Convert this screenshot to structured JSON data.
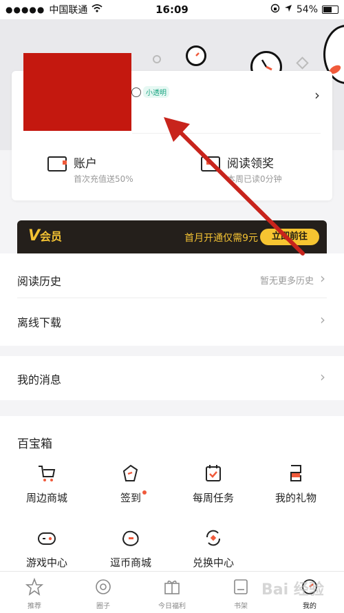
{
  "status_bar": {
    "carrier": "中国联通",
    "time": "16:09",
    "battery": "54%"
  },
  "profile": {
    "badge": "小透明"
  },
  "stats": [
    {
      "title": "账户",
      "sub": "首次充值送50%"
    },
    {
      "title": "阅读领奖",
      "sub": "本周已读0分钟"
    }
  ],
  "vip": {
    "logo_v": "V",
    "logo_text": "会员",
    "promo": "首月开通仅需9元",
    "button": "立即前往"
  },
  "rows": {
    "history": {
      "label": "阅读历史",
      "hint": "暂无更多历史"
    },
    "offline": {
      "label": "离线下载"
    },
    "messages": {
      "label": "我的消息"
    }
  },
  "toolbox": {
    "title": "百宝箱",
    "items": [
      {
        "label": "周边商城",
        "icon": "cart-icon"
      },
      {
        "label": "签到",
        "icon": "checkin-icon"
      },
      {
        "label": "每周任务",
        "icon": "task-icon"
      },
      {
        "label": "我的礼物",
        "icon": "gift-icon"
      },
      {
        "label": "游戏中心",
        "icon": "gamepad-icon"
      },
      {
        "label": "逗币商城",
        "icon": "coin-shop-icon"
      },
      {
        "label": "兑换中心",
        "icon": "exchange-icon"
      }
    ]
  },
  "tabs": [
    {
      "label": "推荐",
      "icon": "star-icon"
    },
    {
      "label": "圈子",
      "icon": "circle-icon"
    },
    {
      "label": "今日福利",
      "icon": "gift-box-icon"
    },
    {
      "label": "书架",
      "icon": "bookshelf-icon"
    },
    {
      "label": "我的",
      "icon": "profile-icon"
    }
  ],
  "watermark": "Bai 经验",
  "colors": {
    "accent": "#f05a3b",
    "vip_gold": "#f3c233",
    "vip_bg": "#241f1b",
    "redacted": "#c4180f",
    "arrow": "#c8241c"
  }
}
